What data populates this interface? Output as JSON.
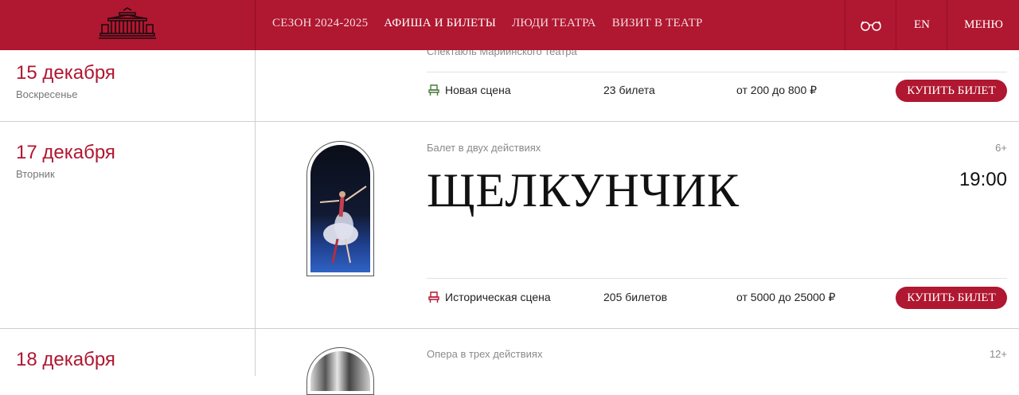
{
  "header": {
    "nav": [
      "СЕЗОН 2024-2025",
      "АФИША И БИЛЕТЫ",
      "ЛЮДИ ТЕАТРА",
      "ВИЗИТ В ТЕАТР"
    ],
    "active_nav": 1,
    "lang": "EN",
    "menu": "МЕНЮ"
  },
  "events": [
    {
      "date": "15 декабря",
      "weekday": "Воскресенье",
      "genre": "Спектакль Мариинского театра",
      "stage": "Новая сцена",
      "tickets": "23 билета",
      "price": "от 200 до 800 ₽",
      "buy": "КУПИТЬ БИЛЕТ"
    },
    {
      "date": "17 декабря",
      "weekday": "Вторник",
      "genre": "Балет в двух действиях",
      "age": "6+",
      "title": "ЩЕЛКУНЧИК",
      "time": "19:00",
      "stage": "Историческая сцена",
      "tickets": "205 билетов",
      "price": "от 5000 до 25000 ₽",
      "buy": "КУПИТЬ БИЛЕТ"
    },
    {
      "date": "18 декабря",
      "genre": "Опера в трех действиях",
      "age": "12+"
    }
  ],
  "colors": {
    "brand": "#b01730",
    "new_stage_icon": "#4a7a3a",
    "historic_stage_icon": "#b01730"
  }
}
